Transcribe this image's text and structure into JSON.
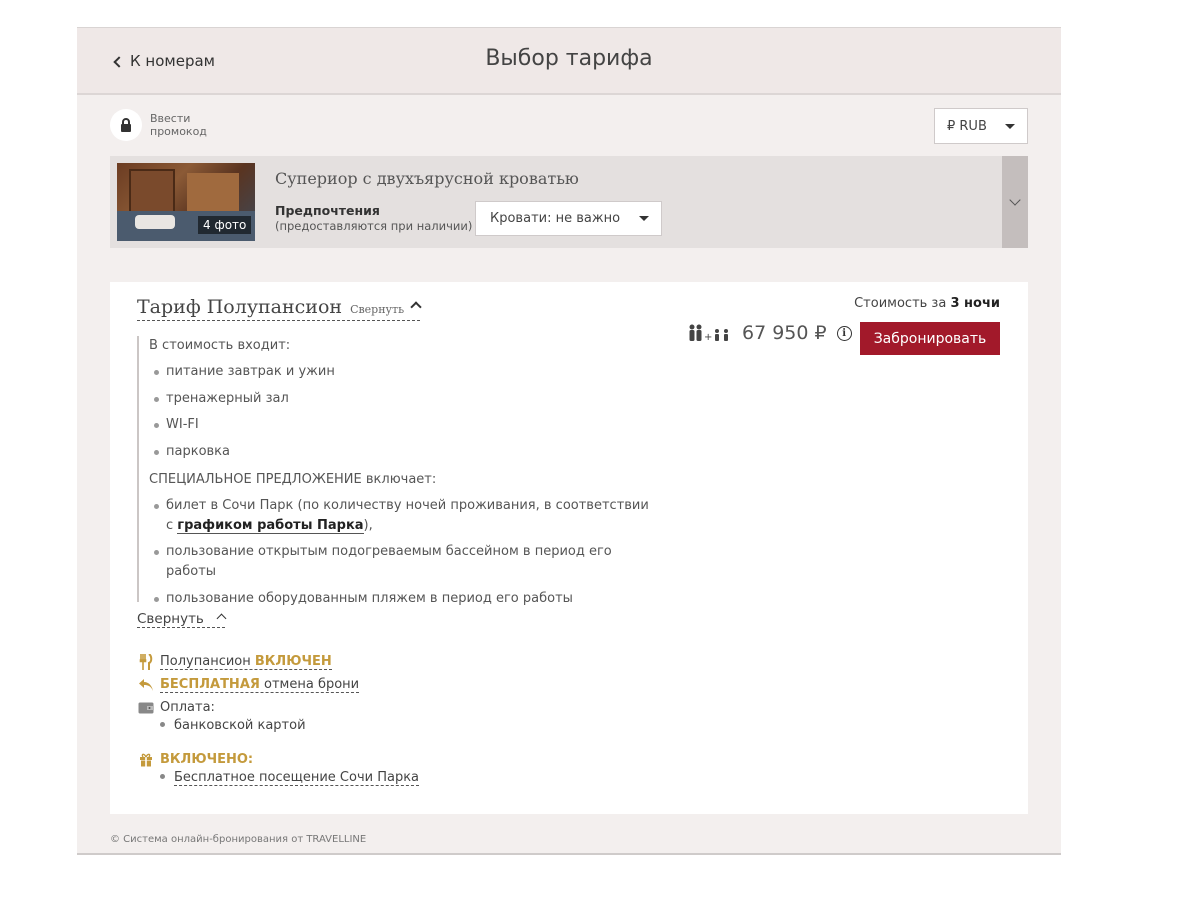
{
  "header": {
    "back_label": "К номерам",
    "title": "Выбор тарифа"
  },
  "promo": {
    "label": "Ввести промокод"
  },
  "currency": {
    "selected": "₽ RUB"
  },
  "room": {
    "name": "Супериор с двухъярусной кроватью",
    "photo_badge": "4 фото",
    "preferences_title": "Предпочтения",
    "preferences_note": "(предоставляются при наличии)",
    "bed_select": "Кровати: не важно"
  },
  "tariff": {
    "name": "Тариф Полупансион",
    "collapse_label": "Свернуть",
    "included_header": "В стоимость входит:",
    "included_items": [
      "питание завтрак и ужин",
      "тренажерный зал",
      "WI-FI",
      "парковка"
    ],
    "special_header": "СПЕЦИАЛЬНОЕ ПРЕДЛОЖЕНИЕ включает:",
    "special_item1_prefix": "билет в Сочи Парк (по количеству ночей проживания, в соответствии с",
    "special_item1_link": "графиком работы Парка",
    "special_item1_suffix": "),",
    "special_item2": "пользование открытым подогреваемым бассейном в период его работы",
    "special_item3": "пользование оборудованным пляжем в период его работы",
    "collapse_bottom_label": "Свернуть",
    "meal_label": "Полупансион",
    "meal_status": "ВКЛЮЧЕН",
    "cancel_free": "БЕСПЛАТНАЯ",
    "cancel_label": "отмена брони",
    "payment_label": "Оплата:",
    "payment_method": "банковской картой",
    "included_bonus_title": "ВКЛЮЧЕНО:",
    "included_bonus_item": "Бесплатное посещение Сочи Парка"
  },
  "price": {
    "stay_prefix": "Стоимость за",
    "stay_nights": "3 ночи",
    "amount": "67 950 ₽",
    "book_button": "Забронировать"
  },
  "footer": {
    "text": "© Система онлайн-бронирования от TRAVELLINE"
  },
  "colors": {
    "accent": "#a2192a",
    "gold": "#c49a3c",
    "background": "#f3efee"
  }
}
